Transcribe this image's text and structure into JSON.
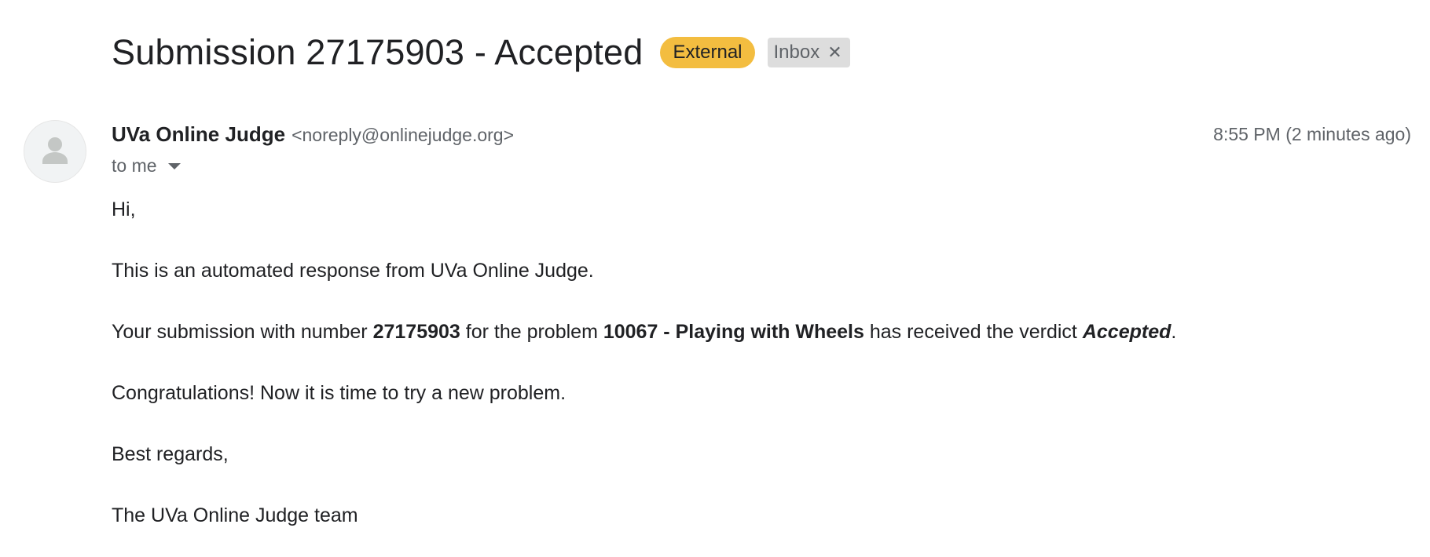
{
  "email": {
    "subject": "Submission 27175903 - Accepted",
    "labels": {
      "external": "External",
      "inbox": "Inbox",
      "inbox_remove": "✕"
    },
    "sender": {
      "name": "UVa Online Judge",
      "email": "<noreply@onlinejudge.org>",
      "avatar_icon": "person-icon"
    },
    "timestamp": "8:55 PM (2 minutes ago)",
    "recipient": "to me",
    "body": {
      "greeting": "Hi,",
      "intro": "This is an automated response from UVa Online Judge.",
      "verdict_line": {
        "prefix": "Your submission with number ",
        "submission_number": "27175903",
        "middle": " for the problem ",
        "problem": "10067 - Playing with Wheels",
        "suffix": " has received the verdict ",
        "verdict": "Accepted",
        "end": "."
      },
      "congrats": "Congratulations! Now it is time to try a new problem.",
      "closing": "Best regards,",
      "signature": "The UVa Online Judge team"
    }
  },
  "colors": {
    "external_label_bg": "#f3bd40",
    "inbox_label_bg": "#dddddd",
    "muted_text": "#5f6368",
    "primary_text": "#202124"
  }
}
